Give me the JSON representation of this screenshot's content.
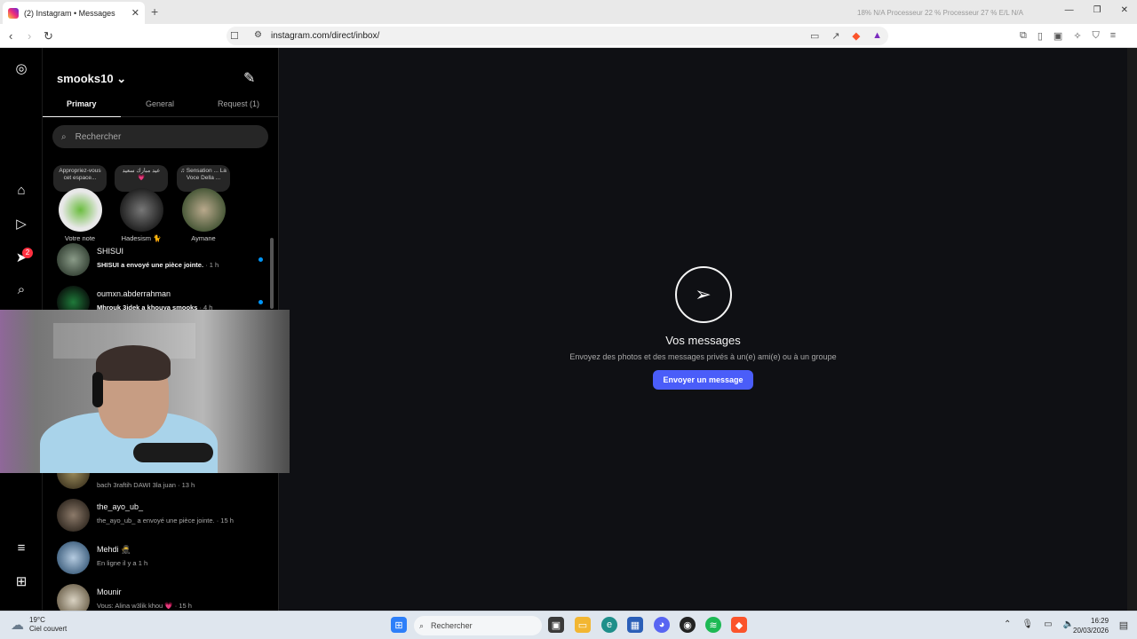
{
  "browser": {
    "tab_title": "(2) Instagram • Messages",
    "url": "instagram.com/direct/inbox/",
    "sysmon_text": "18%  N/A      Processeur         22 %     Processeur  27 %    E/L  N/A"
  },
  "inbox": {
    "username": "smooks10",
    "tabs": [
      "Primary",
      "General",
      "Request (1)"
    ],
    "search_placeholder": "Rechercher",
    "notes": [
      {
        "bubble": "Appropriez-vous cet espace...",
        "name": "Votre note"
      },
      {
        "bubble": "عيد مبارك سعيد 💗",
        "name": "Hadesism 🐈"
      },
      {
        "bubble": "♫ Sensation ... La Voce Della ...",
        "name": "Aymane"
      }
    ],
    "threads": [
      {
        "name": "SHISUI",
        "preview": "SHISUI a envoyé une pièce jointe.",
        "time": " · 1 h",
        "unread": true
      },
      {
        "name": "oumxn.abderrahman",
        "preview": "Mhrouk 3idek a khouya smooks",
        "time": " · 4 h",
        "unread": true
      },
      {
        "name": "",
        "preview": "bach 3raftih DAWI 3la juan",
        "time": " · 13 h",
        "unread": false
      },
      {
        "name": "the_ayo_ub_",
        "preview": "the_ayo_ub_ a envoyé une pièce jointe.",
        "time": " · 15 h",
        "unread": false
      },
      {
        "name": "Mehdi 🥷",
        "preview": "En ligne il y a 1 h",
        "time": "",
        "unread": false
      },
      {
        "name": "Mounir",
        "preview": "Vous: Alina w3lik khou 💗",
        "time": " · 15 h",
        "unread": false
      }
    ]
  },
  "rail": {
    "icons": [
      "instagram-logo-icon",
      "home-icon",
      "reels-icon",
      "messenger-icon",
      "search-icon",
      "menu-icon",
      "more-apps-icon"
    ],
    "notif_count": "2"
  },
  "main": {
    "title": "Vos messages",
    "subtitle": "Envoyez des photos et des messages privés à un(e) ami(e) ou à un groupe",
    "button": "Envoyer un message"
  },
  "taskbar": {
    "temp": "19°C",
    "weather": "Ciel couvert",
    "search": "Rechercher",
    "time": "16:29",
    "date": "20/03/2026"
  },
  "colors": {
    "accent_button": "#4a5df9",
    "unread_dot": "#0095f6",
    "notif_badge": "#ff3040"
  }
}
